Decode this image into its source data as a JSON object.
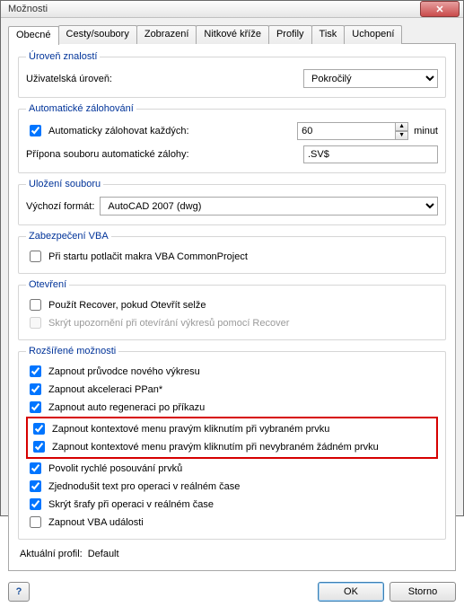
{
  "window": {
    "title": "Možnosti"
  },
  "tabs": [
    "Obecné",
    "Cesty/soubory",
    "Zobrazení",
    "Nitkové kříže",
    "Profily",
    "Tisk",
    "Uchopení"
  ],
  "knowledge": {
    "legend": "Úroveň znalostí",
    "label": "Uživatelská úroveň:",
    "value": "Pokročilý"
  },
  "backup": {
    "legend": "Automatické zálohování",
    "chk_label": "Automaticky zálohovat každých:",
    "interval": "60",
    "unit": "minut",
    "suffix_label": "Přípona souboru automatické zálohy:",
    "suffix_value": ".SV$"
  },
  "save": {
    "legend": "Uložení souboru",
    "label": "Výchozí formát:",
    "value": "AutoCAD 2007 (dwg)"
  },
  "vba": {
    "legend": "Zabezpečení VBA",
    "chk_label": "Při startu potlačit makra VBA CommonProject"
  },
  "open": {
    "legend": "Otevření",
    "chk1": "Použít Recover, pokud Otevřít selže",
    "chk2": "Skrýt upozornění při otevírání výkresů pomocí Recover"
  },
  "ext": {
    "legend": "Rozšířené možnosti",
    "items": [
      "Zapnout průvodce nového výkresu",
      "Zapnout akceleraci PPan*",
      "Zapnout auto regeneraci po příkazu",
      "Zapnout kontextové menu pravým kliknutím při vybraném prvku",
      "Zapnout kontextové menu pravým kliknutím při nevybraném žádném prvku",
      "Povolit rychlé posouvání prvků",
      "Zjednodušit text pro operaci v reálném čase",
      "Skrýt šrafy při operaci v reálném čase",
      "Zapnout VBA události"
    ]
  },
  "profile": {
    "label": "Aktuální profil:",
    "value": "Default"
  },
  "buttons": {
    "help": "?",
    "ok": "OK",
    "cancel": "Storno"
  }
}
